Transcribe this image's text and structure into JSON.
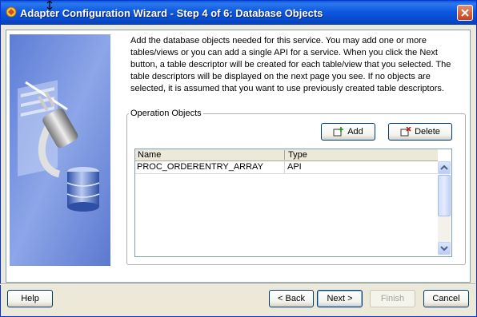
{
  "window": {
    "title": "Adapter Configuration Wizard - Step 4 of 6: Database Objects"
  },
  "description": "Add the database objects needed for this service. You may add one or more tables/views or you can add a single API for a service.  When you click the Next button, a table descriptor will be created for each table/view that you selected.  The table descriptors will be displayed on the next page you see. If no objects are selected, it is assumed that you want to use previously created table descriptors.",
  "operation_objects": {
    "legend": "Operation Objects",
    "add_label": "Add",
    "delete_label": "Delete",
    "columns": [
      "Name",
      "Type"
    ],
    "rows": [
      {
        "name": "PROC_ORDERENTRY_ARRAY",
        "type": "API"
      }
    ]
  },
  "footer": {
    "help_label": "Help",
    "back_label": "< Back",
    "next_label": "Next >",
    "finish_label": "Finish",
    "cancel_label": "Cancel"
  },
  "colors": {
    "titlebar": "#0a5bd8",
    "close_button": "#c9401c",
    "dialog_bg": "#ece9d8",
    "border": "#7f9db9"
  },
  "icons": [
    "wizard-app-icon",
    "close-icon",
    "add-icon",
    "delete-icon",
    "scroll-up-icon",
    "scroll-down-icon",
    "plug-database-illustration"
  ]
}
